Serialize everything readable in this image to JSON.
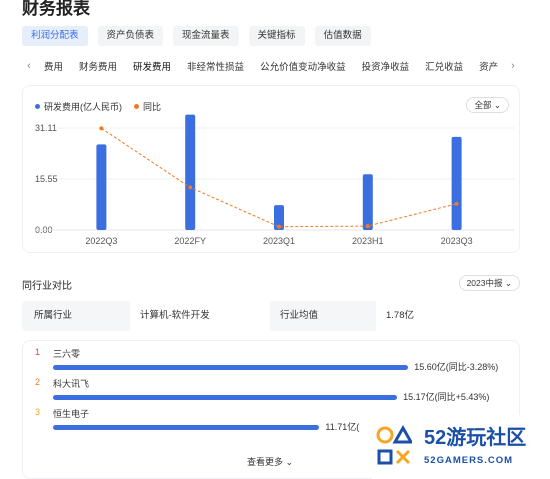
{
  "page": {
    "title": "财务报表"
  },
  "filters": [
    "利润分配表",
    "资产负债表",
    "现金流量表",
    "关键指标",
    "估值数据"
  ],
  "tabs": [
    "费用",
    "财务费用",
    "研发费用",
    "非经常性损益",
    "公允价值变动净收益",
    "投资净收益",
    "汇兑收益",
    "资产"
  ],
  "chart": {
    "legend_bar": "研发费用(亿人民币)",
    "legend_line": "同比",
    "range_select": "全部",
    "colors": {
      "bar": "#3b6fe0",
      "line": "#f07a22"
    }
  },
  "chart_data": {
    "type": "bar",
    "categories": [
      "2022Q3",
      "2022FY",
      "2023Q1",
      "2023H1",
      "2023Q3"
    ],
    "series": [
      {
        "name": "研发费用(亿人民币)",
        "type": "bar",
        "values": [
          26.1,
          35.2,
          7.6,
          17.0,
          28.4
        ]
      },
      {
        "name": "同比",
        "type": "line",
        "values": [
          31.0,
          13.0,
          1.0,
          1.2,
          8.0
        ]
      }
    ],
    "yticks": [
      "31.11",
      "15.55",
      "0.00"
    ],
    "ylim": [
      0,
      31.11
    ]
  },
  "comparison": {
    "title": "同行业对比",
    "period": "2023中报",
    "industry_label": "所属行业",
    "industry_value": "计算机-软件开发",
    "avg_label": "行业均值",
    "avg_value": "1.78亿",
    "items": [
      {
        "rank": "1",
        "name": "三六零",
        "value": "15.60亿(同比-3.28%)",
        "fraction": 0.96
      },
      {
        "rank": "2",
        "name": "科大讯飞",
        "value": "15.17亿(同比+5.43%)",
        "fraction": 0.93
      },
      {
        "rank": "3",
        "name": "恒生电子",
        "value": "11.71亿(",
        "fraction": 0.72
      }
    ],
    "see_more": "查看更多",
    "rank_colors": [
      "#e8452b",
      "#f07a22",
      "#f5a623"
    ]
  },
  "watermark": {
    "brand": "52游玩社区",
    "domain": "52GAMERS.COM"
  }
}
